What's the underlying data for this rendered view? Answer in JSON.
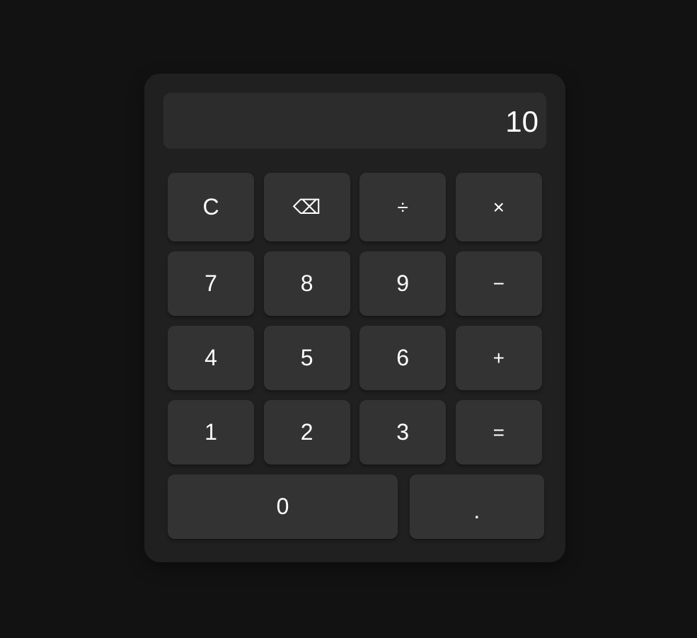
{
  "display": {
    "value": "10"
  },
  "keys": {
    "clear": "C",
    "backspace": "⌫",
    "divide": "÷",
    "multiply": "×",
    "seven": "7",
    "eight": "8",
    "nine": "9",
    "subtract": "−",
    "four": "4",
    "five": "5",
    "six": "6",
    "add": "+",
    "one": "1",
    "two": "2",
    "three": "3",
    "equals": "=",
    "zero": "0",
    "decimal": "."
  },
  "colors": {
    "background": "#121212",
    "panel": "#202020",
    "display": "#2c2c2c",
    "key": "#333333",
    "text": "#ffffff"
  }
}
